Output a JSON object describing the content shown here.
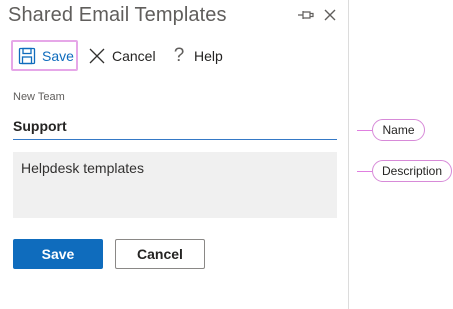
{
  "panel": {
    "title": "Shared Email Templates",
    "pin_icon": "pin-icon",
    "close_icon": "close-icon"
  },
  "toolbar": {
    "save_label": "Save",
    "save_icon": "floppy-disk-icon",
    "cancel_label": "Cancel",
    "cancel_icon": "x-icon",
    "help_label": "Help",
    "help_glyph": "?"
  },
  "form": {
    "field_label": "New Team",
    "name_value": "Support",
    "description_value": "Helpdesk templates"
  },
  "buttons": {
    "save": "Save",
    "cancel": "Cancel"
  },
  "callouts": {
    "name": "Name",
    "description": "Description"
  },
  "colors": {
    "accent": "#0f6cbd",
    "highlight_border": "#e6a7e8",
    "callout": "#d78ad8"
  }
}
